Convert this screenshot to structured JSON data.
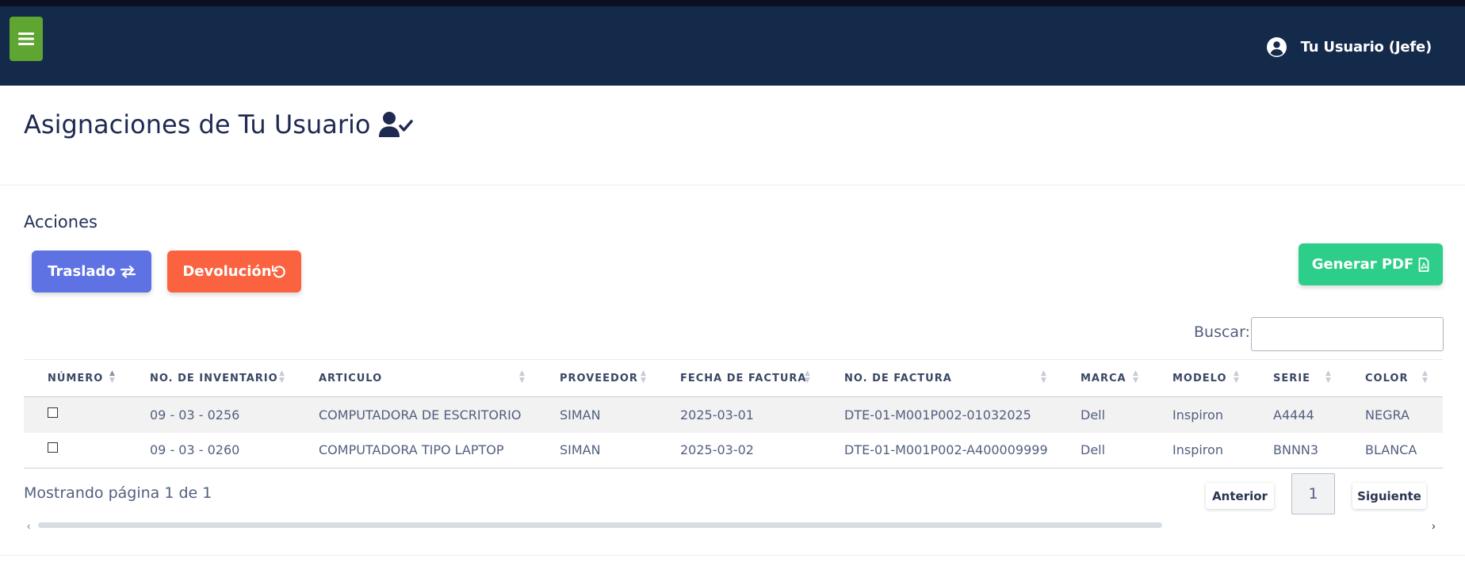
{
  "navbar": {
    "menu_icon": "hamburger-icon",
    "user_icon": "user-circle-icon",
    "user_name": "Tu Usuario (Jefe)",
    "bg_color": "#142a4a",
    "menu_color": "#5ea532"
  },
  "page": {
    "title": "Asignaciones de Tu Usuario",
    "title_icon": "user-check-icon"
  },
  "actions": {
    "label": "Acciones",
    "traslado": "Traslado",
    "traslado_icon": "exchange-arrows-icon",
    "devolucion": "Devolución",
    "devolucion_icon": "undo-icon",
    "pdf": "Generar PDF",
    "pdf_icon": "file-pdf-icon",
    "colors": {
      "traslado": "#5e72e4",
      "devolucion": "#fb6340",
      "pdf": "#2dce89"
    }
  },
  "search": {
    "label": "Buscar:",
    "value": ""
  },
  "table": {
    "headers": [
      "NÚMERO",
      "NO. DE INVENTARIO",
      "ARTICULO",
      "PROVEEDOR",
      "FECHA DE FACTURA",
      "NO. DE FACTURA",
      "MARCA",
      "MODELO",
      "SERIE",
      "COLOR"
    ],
    "rows": [
      [
        "",
        "09 - 03 - 0256",
        "COMPUTADORA DE ESCRITORIO",
        "SIMAN",
        "2025-03-01",
        "DTE-01-M001P002-01032025",
        "Dell",
        "Inspiron",
        "A4444",
        "NEGRA"
      ],
      [
        "",
        "09 - 03 - 0260",
        "COMPUTADORA TIPO LAPTOP",
        "SIMAN",
        "2025-03-02",
        "DTE-01-M001P002-A400009999",
        "Dell",
        "Inspiron",
        "BNNN3",
        "BLANCA"
      ]
    ]
  },
  "pagination": {
    "info": "Mostrando página 1 de 1",
    "prev": "Anterior",
    "page": "1",
    "next": "Siguiente"
  },
  "scroll": {
    "left_icon": "chevron-left-icon",
    "right_icon": "chevron-right-icon"
  }
}
